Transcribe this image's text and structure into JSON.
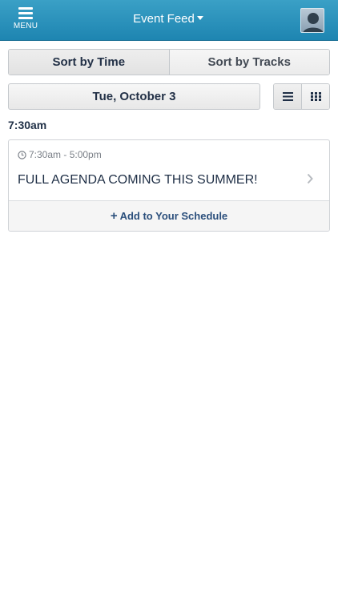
{
  "header": {
    "menu_label": "MENU",
    "title": "Event Feed",
    "menu_icon": "hamburger-icon",
    "title_icon": "caret-down-icon",
    "avatar_icon": "user-avatar-icon"
  },
  "sort": {
    "tabs": [
      {
        "label": "Sort by Time",
        "selected": true
      },
      {
        "label": "Sort by Tracks",
        "selected": false
      }
    ]
  },
  "date": {
    "label": "Tue, October 3"
  },
  "view_toggle": {
    "options": [
      {
        "icon": "list-view-icon",
        "selected": true
      },
      {
        "icon": "grid-view-icon",
        "selected": false
      }
    ]
  },
  "schedule": {
    "time_heading": "7:30am",
    "events": [
      {
        "time_range": "7:30am - 5:00pm",
        "title": "FULL AGENDA COMING THIS SUMMER!",
        "action_label": "Add to Your Schedule",
        "action_icon": "plus-icon",
        "time_icon": "clock-icon",
        "chevron_icon": "chevron-right-icon"
      }
    ]
  },
  "colors": {
    "header_top": "#3aa0c6",
    "header_bottom": "#1e85b1",
    "text_dark": "#1f2f46",
    "action_blue": "#2b4f7c"
  }
}
